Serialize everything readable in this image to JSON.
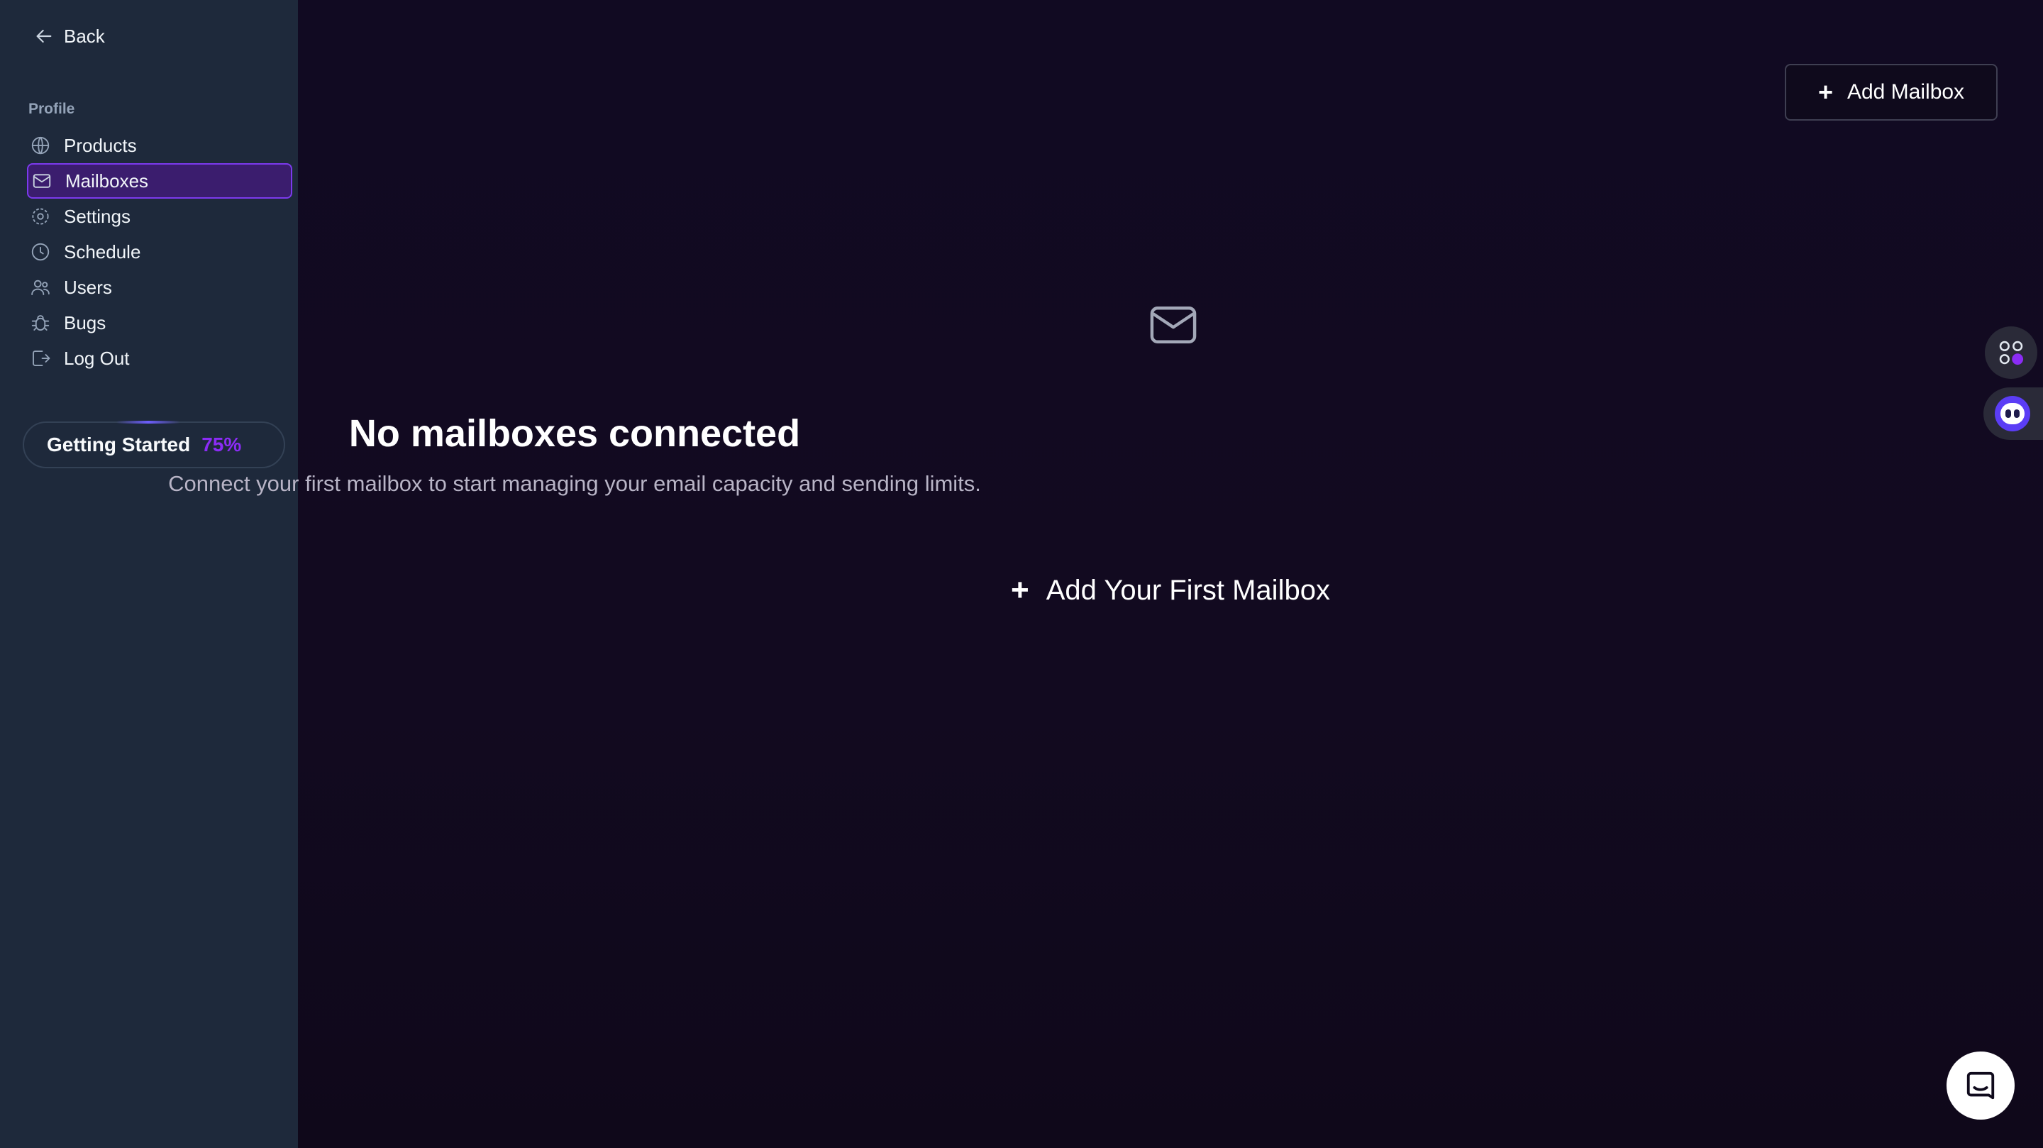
{
  "sidebar": {
    "back_label": "Back",
    "section_label": "Profile",
    "items": [
      {
        "label": "Products",
        "icon": "globe-icon"
      },
      {
        "label": "Mailboxes",
        "icon": "mail-icon"
      },
      {
        "label": "Settings",
        "icon": "gear-icon"
      },
      {
        "label": "Schedule",
        "icon": "clock-icon"
      },
      {
        "label": "Users",
        "icon": "users-icon"
      },
      {
        "label": "Bugs",
        "icon": "bug-icon"
      },
      {
        "label": "Log Out",
        "icon": "logout-icon"
      }
    ],
    "active_item": "Mailboxes",
    "getting_started": {
      "label": "Getting Started",
      "percent": "75%"
    }
  },
  "main": {
    "add_mailbox_label": "Add Mailbox",
    "empty_state": {
      "icon": "mail-icon",
      "title": "No mailboxes connected",
      "description": "Connect your first mailbox to start managing your email capacity and sending limits.",
      "cta_label": "Add Your First Mailbox"
    }
  },
  "widgets": {
    "apps": "apps-grid-icon",
    "bot": "bot-icon",
    "chat": "chat-icon"
  },
  "colors": {
    "sidebar_bg": "#1e293b",
    "main_bg": "#110a22",
    "accent": "#7c3aed",
    "percent": "#8b2cf5"
  }
}
